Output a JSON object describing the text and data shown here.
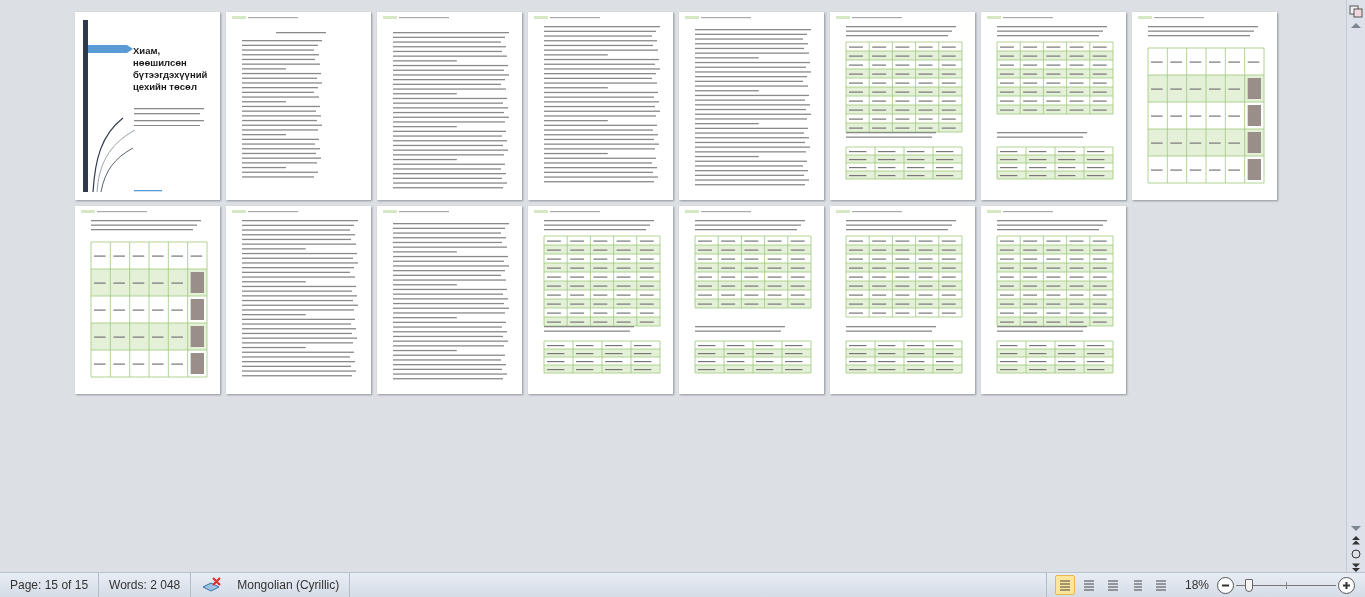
{
  "document": {
    "pages": [
      {
        "kind": "cover",
        "title": "Хиам, нөөшилсөн бүтээгдэхүүний цехийн төсөл"
      },
      {
        "kind": "toc"
      },
      {
        "kind": "text"
      },
      {
        "kind": "text"
      },
      {
        "kind": "text"
      },
      {
        "kind": "table"
      },
      {
        "kind": "table"
      },
      {
        "kind": "photo-table"
      },
      {
        "kind": "photo-table"
      },
      {
        "kind": "text"
      },
      {
        "kind": "text"
      },
      {
        "kind": "table"
      },
      {
        "kind": "table"
      },
      {
        "kind": "table"
      },
      {
        "kind": "table"
      }
    ]
  },
  "status_bar": {
    "page": "Page: 15 of 15",
    "words": "Words: 2 048",
    "language": "Mongolian (Cyrillic)",
    "views": [
      {
        "selected": true
      },
      {
        "selected": false
      },
      {
        "selected": false
      },
      {
        "selected": false
      },
      {
        "selected": false
      }
    ],
    "zoom": "18%",
    "zoom_slider": {
      "level": 0.1
    }
  }
}
